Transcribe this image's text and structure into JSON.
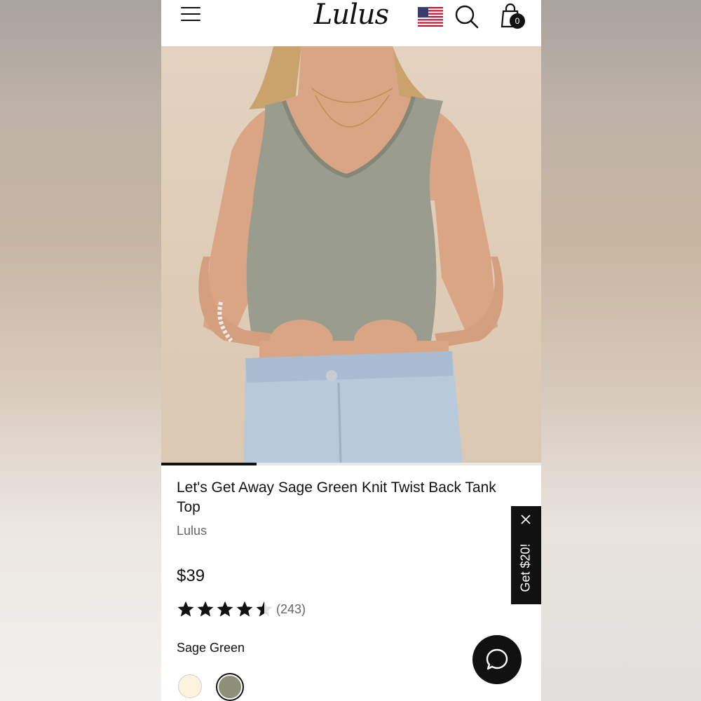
{
  "header": {
    "logo_text": "Lulus",
    "cart_count": "0"
  },
  "hero": {
    "image_count_progress": 0.25
  },
  "product": {
    "title": "Let's Get Away Sage Green Knit Twist Back Tank Top",
    "brand": "Lulus",
    "price": "$39",
    "rating_value": 4.5,
    "rating_count": "(243)",
    "selected_color": "Sage Green",
    "swatches": [
      {
        "name": "cream",
        "color": "#fdf3dc"
      },
      {
        "name": "sage-green",
        "color": "#8e8f77",
        "selected": true
      }
    ]
  },
  "promo": {
    "label": "Get $20!"
  },
  "colors": {
    "accent": "#111111",
    "muted_text": "#666666"
  }
}
